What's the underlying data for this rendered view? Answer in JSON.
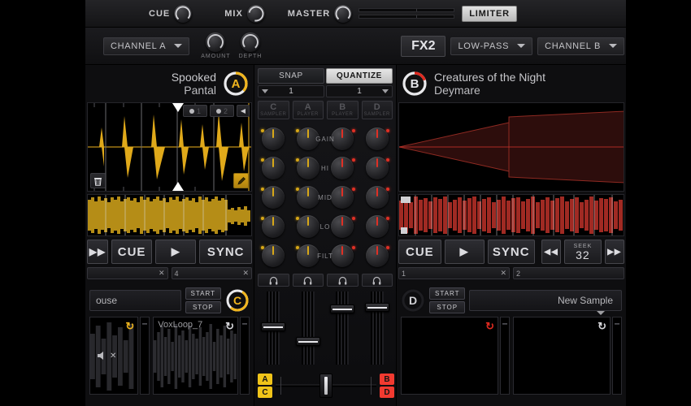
{
  "master_bar": {
    "cue_label": "CUE",
    "mix_label": "MIX",
    "master_label": "MASTER",
    "limiter_label": "LIMITER"
  },
  "fx_bar": {
    "left_channel_label": "CHANNEL A",
    "amount_label": "AMOUNT",
    "depth_label": "DEPTH",
    "fx_unit_label": "FX2",
    "effect_label": "LOW-PASS",
    "right_channel_label": "CHANNEL B"
  },
  "deck_a": {
    "title": "Spooked",
    "artist": "Pantal",
    "badge": "A",
    "accent": "#f0b51e",
    "hotcues": [
      "1",
      "2"
    ],
    "transport": {
      "cue": "CUE",
      "play": "▶",
      "sync": "SYNC",
      "prev": "▶▶"
    },
    "slots": [
      "",
      "4"
    ],
    "slot_clear": "✕"
  },
  "deck_b": {
    "title": "Creatures of the Night",
    "artist": "Deymare",
    "badge": "B",
    "accent": "#e02a20",
    "transport": {
      "cue": "CUE",
      "play": "▶",
      "sync": "SYNC"
    },
    "seek": {
      "label": "SEEK",
      "value": "32",
      "back": "◀◀",
      "fwd": "▶▶"
    },
    "slots": [
      "1",
      "2"
    ],
    "slot_clear": "✕"
  },
  "mixer": {
    "snap_label": "SNAP",
    "quantize_label": "QUANTIZE",
    "snap_value": "1",
    "quantize_value": "1",
    "channels": [
      {
        "letter": "C",
        "role": "SAMPLER",
        "color": "#d8a818"
      },
      {
        "letter": "A",
        "role": "PLAYER",
        "color": "#d8a818"
      },
      {
        "letter": "B",
        "role": "PLAYER",
        "color": "#e03025"
      },
      {
        "letter": "D",
        "role": "SAMPLER",
        "color": "#e03025"
      }
    ],
    "knob_rows": [
      "GAIN",
      "HI",
      "MID",
      "LO",
      "FILT"
    ],
    "headphone_icon": "Ω",
    "fader_positions": [
      42,
      62,
      18,
      16
    ],
    "crossfader": {
      "left_tags": [
        "A",
        "C"
      ],
      "right_tags": [
        "B",
        "D"
      ],
      "left_color": "#f0c419",
      "right_color": "#f23a30",
      "position": 50
    }
  },
  "sampler_c": {
    "badge": "C",
    "accent": "#f0b51e",
    "name_value": "ouse",
    "start_label": "START",
    "stop_label": "STOP",
    "pads": [
      {
        "name": "",
        "loop": true,
        "loop_color": "#f0b51e",
        "muted": true
      },
      {
        "name": "VoxLoop_7",
        "loop": true,
        "loop_color": "#d8d8dc",
        "muted": false
      }
    ]
  },
  "sampler_d": {
    "badge": "D",
    "accent": "#e02a20",
    "name_value": "New Sample",
    "start_label": "START",
    "stop_label": "STOP",
    "pads": [
      {
        "name": "",
        "loop": true,
        "loop_color": "#e02a20"
      },
      {
        "name": "",
        "loop": true,
        "loop_color": "#d8d8dc"
      }
    ]
  }
}
